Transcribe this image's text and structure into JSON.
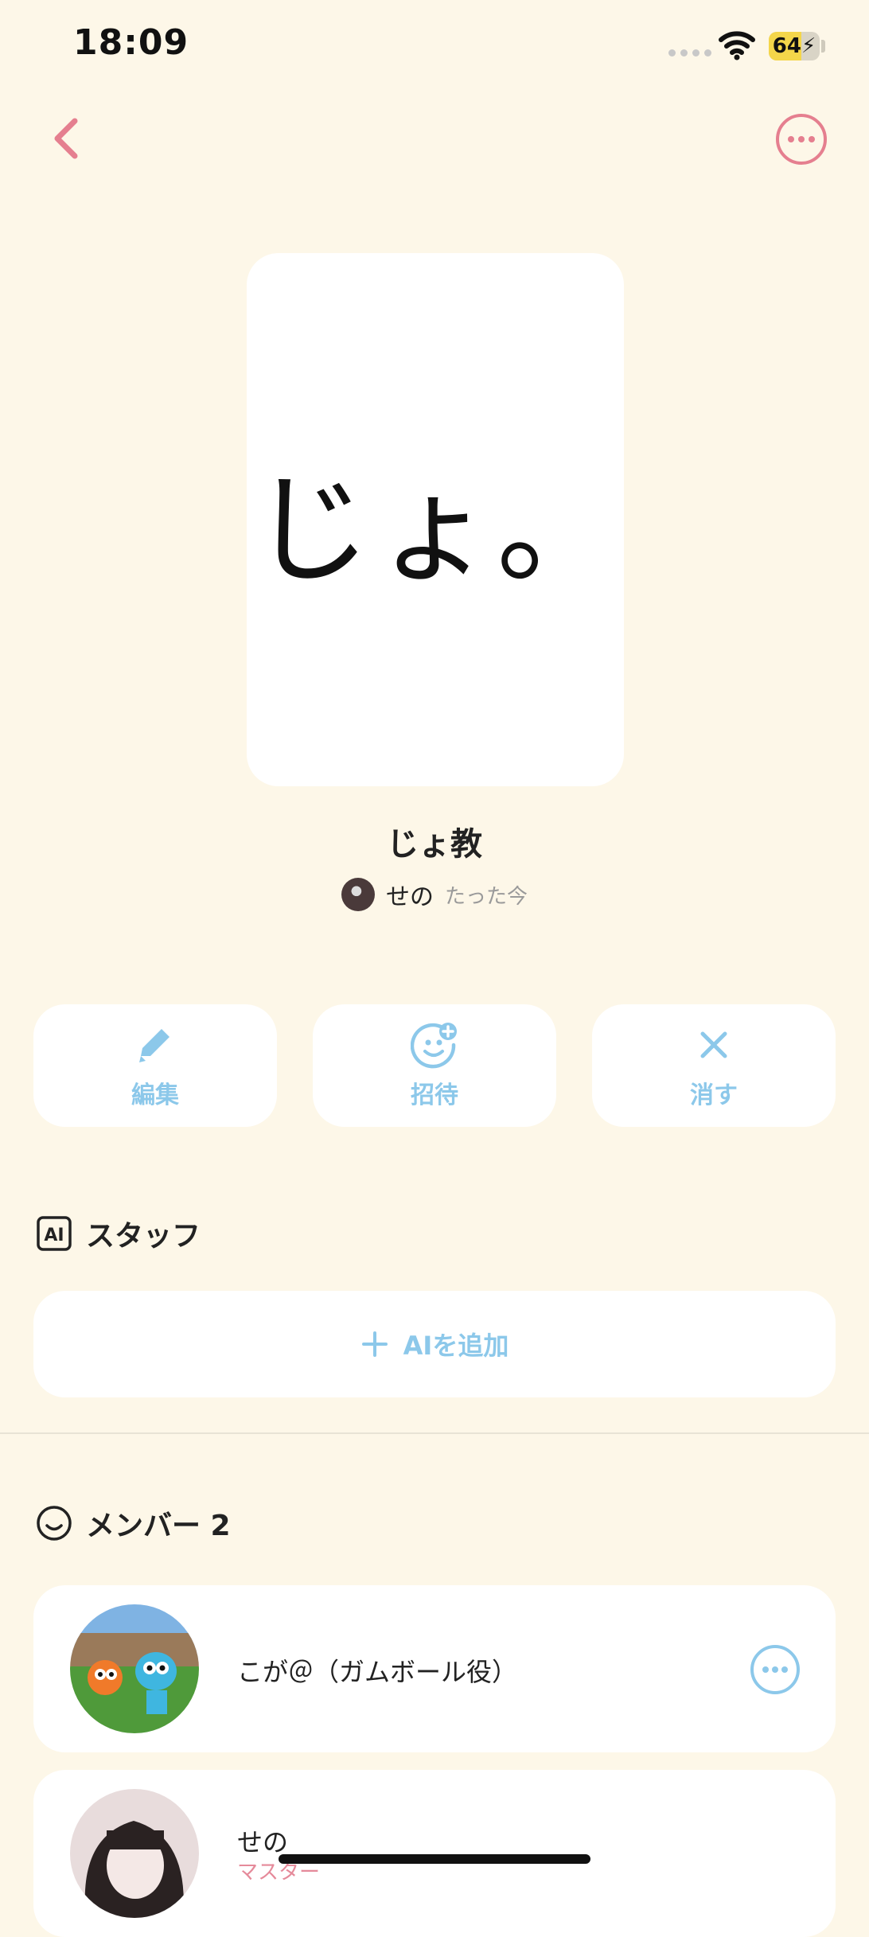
{
  "status": {
    "time": "18:09",
    "battery": "64"
  },
  "colors": {
    "accent_pink": "#e57f8f",
    "accent_blue": "#8cc8ea",
    "background": "#fdf7e8"
  },
  "card": {
    "cover_text": "じょ。",
    "title": "じょ教",
    "author": "せの",
    "time_ago": "たった今"
  },
  "actions": [
    {
      "label": "編集",
      "icon": "pencil-icon"
    },
    {
      "label": "招待",
      "icon": "invite-smile-plus-icon"
    },
    {
      "label": "消す",
      "icon": "close-icon"
    }
  ],
  "ai_staff": {
    "heading": "スタッフ",
    "add_label": "AIを追加"
  },
  "members": {
    "heading": "メンバー 2",
    "items": [
      {
        "name": "こが＠（ガムボール役）",
        "role": ""
      },
      {
        "name": "せの",
        "role": "マスター"
      }
    ]
  }
}
